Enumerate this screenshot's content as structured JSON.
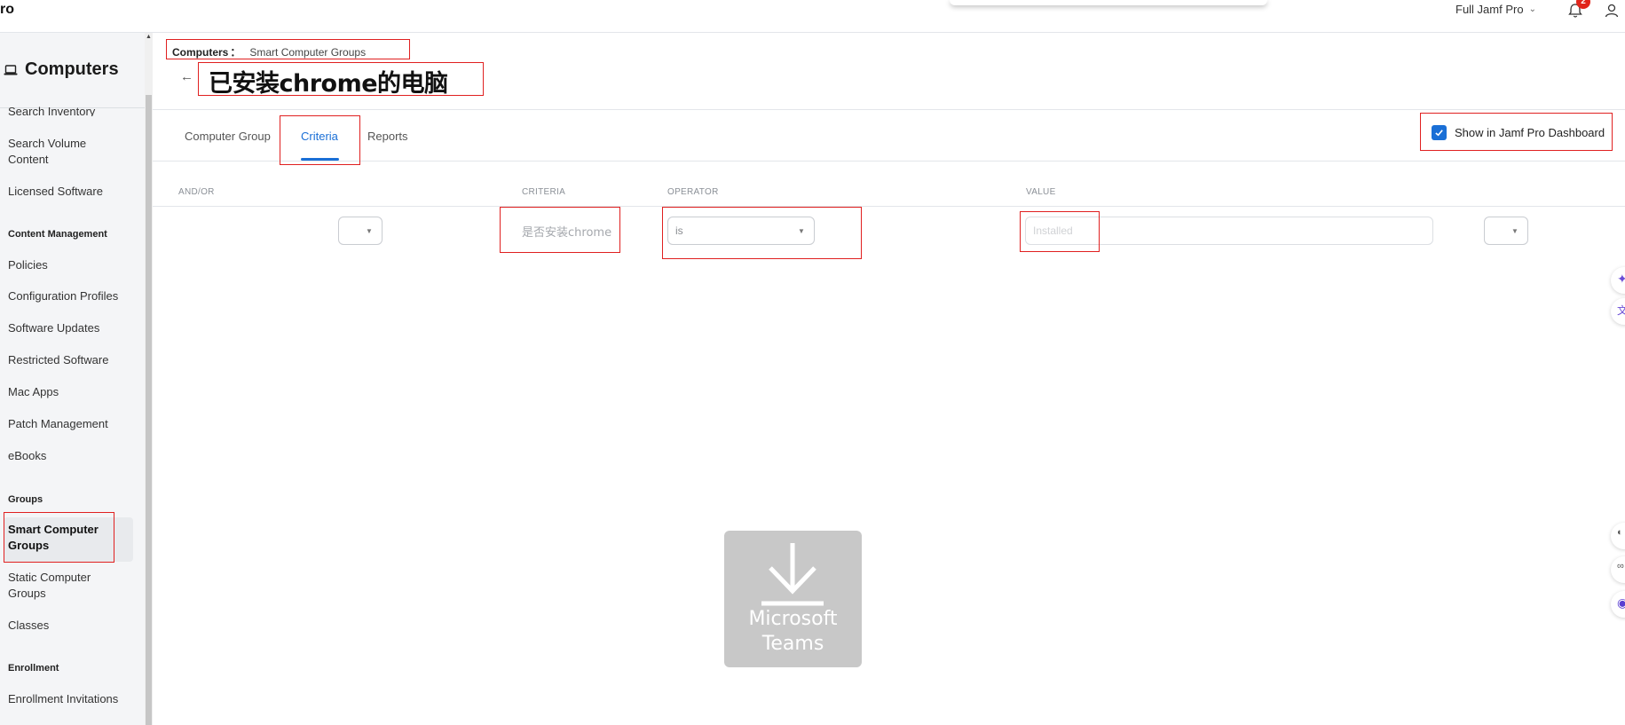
{
  "topbar": {
    "app_fragment": "ro",
    "environment": "Full Jamf Pro",
    "notification_count": "2"
  },
  "sidebar": {
    "title": "Computers",
    "items": [
      {
        "label": "Search Inventory"
      },
      {
        "label": "Search Volume Content"
      },
      {
        "label": "Licensed Software"
      }
    ],
    "sections": [
      {
        "heading": "Content Management",
        "items": [
          "Policies",
          "Configuration Profiles",
          "Software Updates",
          "Restricted Software",
          "Mac Apps",
          "Patch Management",
          "eBooks"
        ]
      },
      {
        "heading": "Groups",
        "items": [
          "Smart Computer Groups",
          "Static Computer Groups",
          "Classes"
        ]
      },
      {
        "heading": "Enrollment",
        "items": [
          "Enrollment Invitations"
        ]
      }
    ]
  },
  "breadcrumb": {
    "root": "Computers",
    "separator": "：",
    "current": "Smart Computer Groups"
  },
  "page": {
    "title": "已安装chrome的电脑"
  },
  "tabs": [
    {
      "label": "Computer Group",
      "active": false
    },
    {
      "label": "Criteria",
      "active": true
    },
    {
      "label": "Reports",
      "active": false
    }
  ],
  "dashboard_toggle": {
    "label": "Show in Jamf Pro Dashboard",
    "checked": true
  },
  "criteria_table": {
    "headers": [
      "AND/OR",
      "CRITERIA",
      "OPERATOR",
      "VALUE"
    ],
    "rows": [
      {
        "and_or": "",
        "criteria": "是否安装chrome",
        "operator": "is",
        "value": "Installed",
        "trailing_select": ""
      }
    ]
  },
  "overlay": {
    "label_line1": "Microsoft",
    "label_line2": "Teams"
  },
  "colors": {
    "accent": "#1a6fd6",
    "annotation": "#e02020",
    "badge": "#e1251b"
  }
}
